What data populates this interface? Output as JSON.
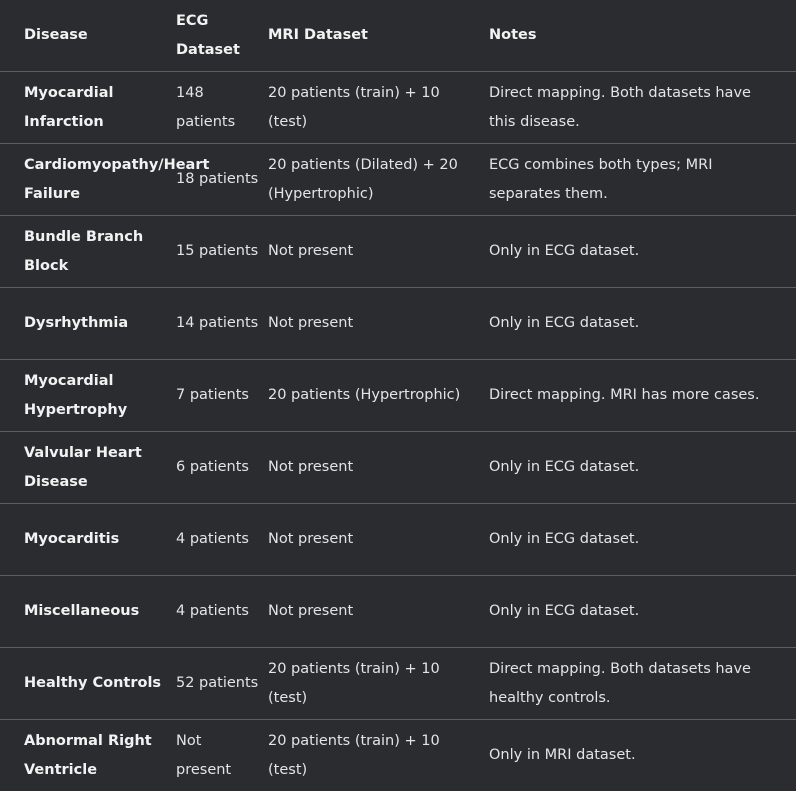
{
  "table": {
    "headers": [
      "Disease",
      "ECG Dataset",
      "MRI Dataset",
      "Notes"
    ],
    "rows": [
      [
        "Myocardial Infarction",
        "148 patients",
        "20 patients (train) + 10 (test)",
        "Direct mapping. Both datasets have this disease."
      ],
      [
        "Cardiomyopathy/Heart Failure",
        "18 patients",
        "20 patients (Dilated) + 20 (Hypertrophic)",
        "ECG combines both types; MRI separates them."
      ],
      [
        "Bundle Branch Block",
        "15 patients",
        "Not present",
        "Only in ECG dataset."
      ],
      [
        "Dysrhythmia",
        "14 patients",
        "Not present",
        "Only in ECG dataset."
      ],
      [
        "Myocardial Hypertrophy",
        "7 patients",
        "20 patients (Hypertrophic)",
        "Direct mapping. MRI has more cases."
      ],
      [
        "Valvular Heart Disease",
        "6 patients",
        "Not present",
        "Only in ECG dataset."
      ],
      [
        "Myocarditis",
        "4 patients",
        "Not present",
        "Only in ECG dataset."
      ],
      [
        "Miscellaneous",
        "4 patients",
        "Not present",
        "Only in ECG dataset."
      ],
      [
        "Healthy Controls",
        "52 patients",
        "20 patients (train) + 10 (test)",
        "Direct mapping. Both datasets have healthy controls."
      ],
      [
        "Abnormal Right Ventricle",
        "Not present",
        "20 patients (train) + 10 (test)",
        "Only in MRI dataset."
      ]
    ]
  }
}
